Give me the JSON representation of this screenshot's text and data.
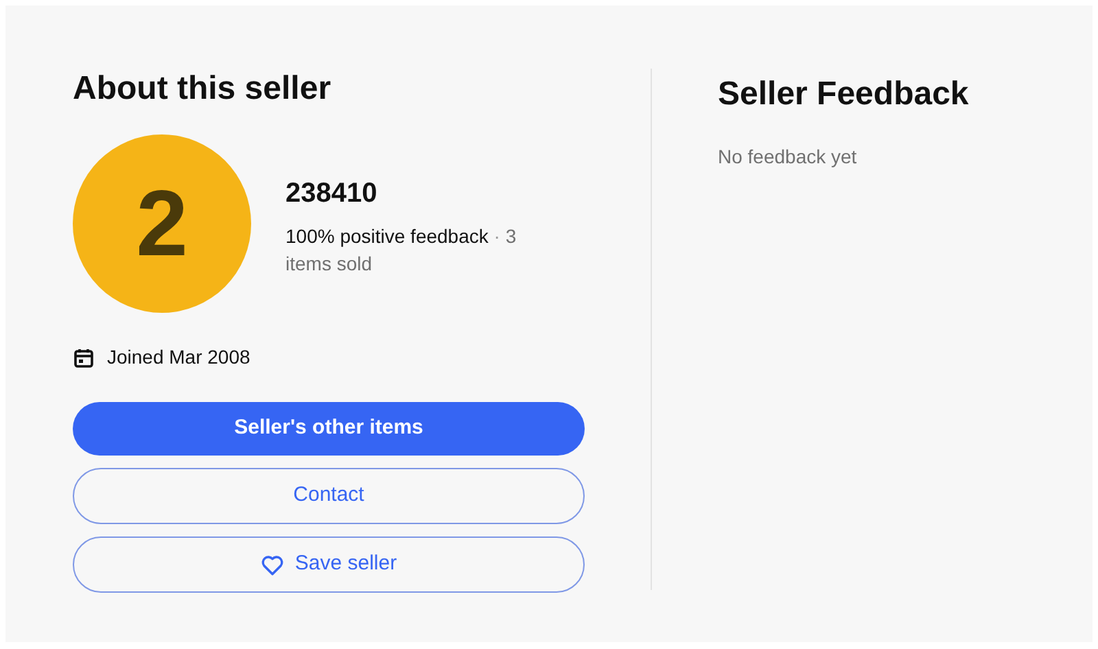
{
  "seller": {
    "title": "About this seller",
    "avatar_initial": "2",
    "name": "238410",
    "positive_feedback": "100% positive feedback",
    "separator": "·",
    "items_sold": "3 items sold",
    "joined": "Joined Mar 2008"
  },
  "buttons": [
    {
      "label": "Seller's other items",
      "kind": "filled"
    },
    {
      "label": "Contact",
      "kind": "outline"
    },
    {
      "label": "Save seller",
      "kind": "save"
    }
  ],
  "feedback": {
    "title": "Seller Feedback",
    "empty_message": "No feedback yet"
  }
}
